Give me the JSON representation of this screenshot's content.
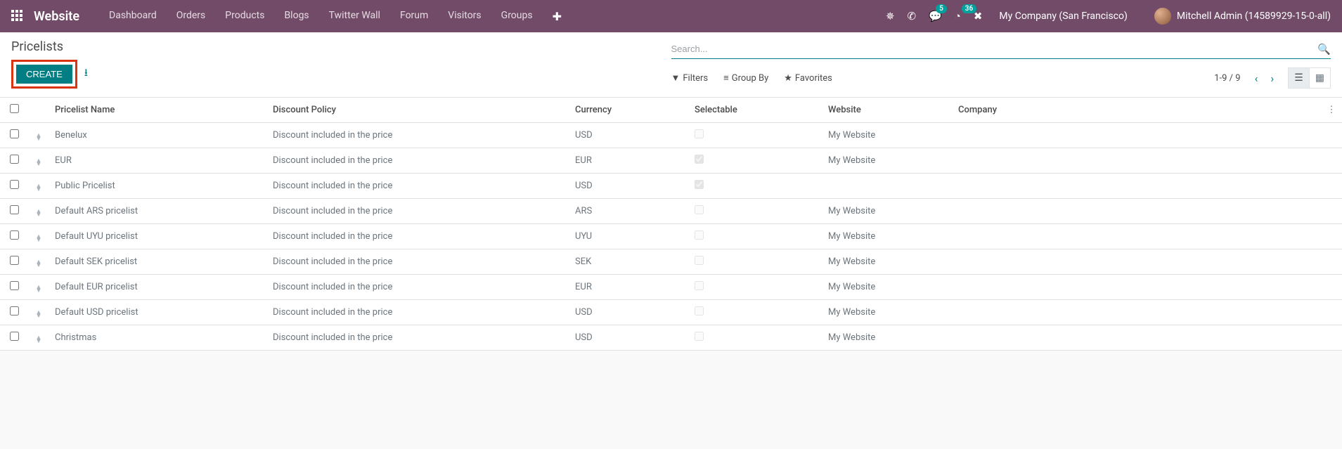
{
  "nav": {
    "brand": "Website",
    "items": [
      "Dashboard",
      "Orders",
      "Products",
      "Blogs",
      "Twitter Wall",
      "Forum",
      "Visitors",
      "Groups"
    ],
    "chat_badge": "5",
    "clock_badge": "36",
    "company": "My Company (San Francisco)",
    "user": "Mitchell Admin (14589929-15-0-all)"
  },
  "page": {
    "title": "Pricelists",
    "create_label": "CREATE",
    "search_placeholder": "Search...",
    "filters_label": "Filters",
    "groupby_label": "Group By",
    "favorites_label": "Favorites",
    "pager": "1-9 / 9"
  },
  "table": {
    "headers": {
      "name": "Pricelist Name",
      "policy": "Discount Policy",
      "currency": "Currency",
      "selectable": "Selectable",
      "website": "Website",
      "company": "Company"
    },
    "rows": [
      {
        "name": "Benelux",
        "policy": "Discount included in the price",
        "currency": "USD",
        "selectable": false,
        "website": "My Website",
        "company": ""
      },
      {
        "name": "EUR",
        "policy": "Discount included in the price",
        "currency": "EUR",
        "selectable": true,
        "website": "My Website",
        "company": ""
      },
      {
        "name": "Public Pricelist",
        "policy": "Discount included in the price",
        "currency": "USD",
        "selectable": true,
        "website": "",
        "company": ""
      },
      {
        "name": "Default ARS pricelist",
        "policy": "Discount included in the price",
        "currency": "ARS",
        "selectable": false,
        "website": "My Website",
        "company": ""
      },
      {
        "name": "Default UYU pricelist",
        "policy": "Discount included in the price",
        "currency": "UYU",
        "selectable": false,
        "website": "My Website",
        "company": ""
      },
      {
        "name": "Default SEK pricelist",
        "policy": "Discount included in the price",
        "currency": "SEK",
        "selectable": false,
        "website": "My Website",
        "company": ""
      },
      {
        "name": "Default EUR pricelist",
        "policy": "Discount included in the price",
        "currency": "EUR",
        "selectable": false,
        "website": "My Website",
        "company": ""
      },
      {
        "name": "Default USD pricelist",
        "policy": "Discount included in the price",
        "currency": "USD",
        "selectable": false,
        "website": "My Website",
        "company": ""
      },
      {
        "name": "Christmas",
        "policy": "Discount included in the price",
        "currency": "USD",
        "selectable": false,
        "website": "My Website",
        "company": ""
      }
    ]
  }
}
